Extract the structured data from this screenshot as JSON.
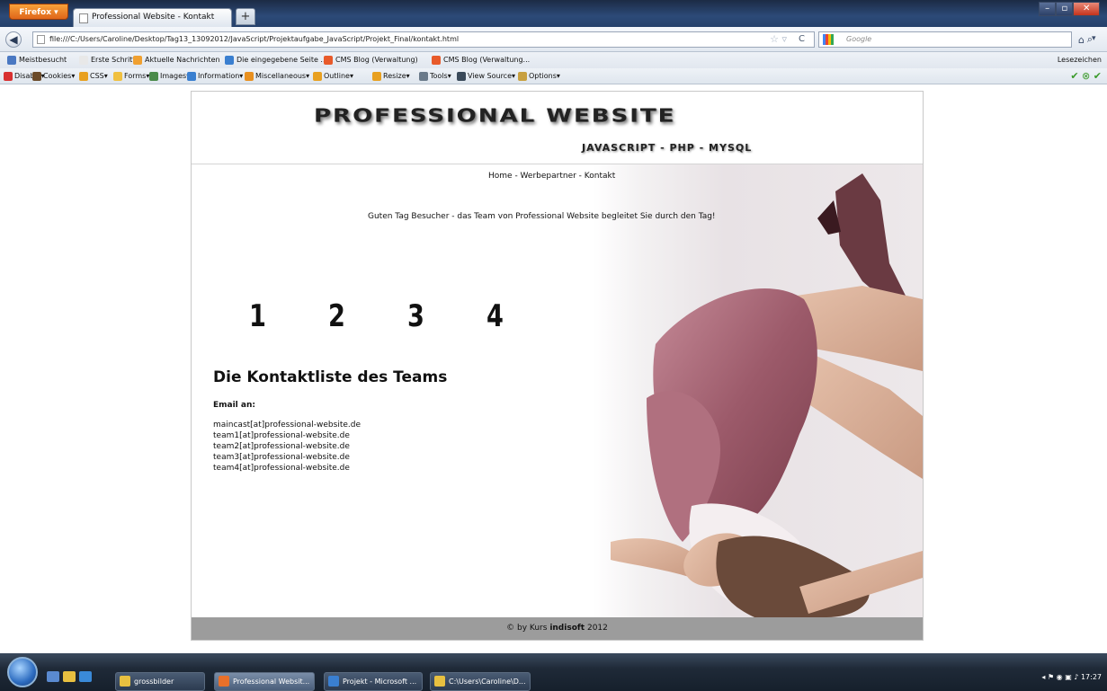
{
  "browser": {
    "menu_button": "Firefox ▾",
    "tab_title": "Professional Website - Kontakt",
    "new_tab": "+",
    "url": "file:///C:/Users/Caroline/Desktop/Tag13_13092012/JavaScript/Projektaufgabe_JavaScript/Projekt_Final/kontakt.html",
    "search_placeholder": "Google",
    "bookmarks": [
      {
        "label": "Meistbesucht",
        "color": "#4a78c2"
      },
      {
        "label": "Erste Schritte",
        "color": "#e8e8e8"
      },
      {
        "label": "Aktuelle Nachrichten",
        "color": "#f0a030"
      },
      {
        "label": "Die eingegebene Seite ...",
        "color": "#3a7fd0"
      },
      {
        "label": "CMS Blog (Verwaltung)",
        "color": "#e85a2a"
      },
      {
        "label": "CMS Blog (Verwaltung...",
        "color": "#e85a2a"
      }
    ],
    "bookmarks_right": "Lesezeichen",
    "devtools": [
      {
        "label": "Disable▾",
        "color": "#d83030"
      },
      {
        "label": "Cookies▾",
        "color": "#6a4a2a"
      },
      {
        "label": "CSS▾",
        "color": "#e8a020"
      },
      {
        "label": "Forms▾",
        "color": "#f0c040"
      },
      {
        "label": "Images▾",
        "color": "#4a8a4a"
      },
      {
        "label": "Information▾",
        "color": "#3a7fd0"
      },
      {
        "label": "Miscellaneous▾",
        "color": "#e89020"
      },
      {
        "label": "Outline▾",
        "color": "#e8a020"
      },
      {
        "label": "Resize▾",
        "color": "#e8a020"
      },
      {
        "label": "Tools▾",
        "color": "#6a7a8a"
      },
      {
        "label": "View Source▾",
        "color": "#3a4a5a"
      },
      {
        "label": "Options▾",
        "color": "#c8a040"
      }
    ],
    "status_icons": "✔ ⊗ ✔"
  },
  "site": {
    "logo": "PROFESSIONAL WEBSITE",
    "slogan": "JAVASCRIPT - PHP - MYSQL",
    "nav": "Home - Werbepartner - Kontakt",
    "greeting": "Guten Tag Besucher - das Team von Professional Website begleitet Sie durch den Tag!",
    "numbers": [
      "1",
      "2",
      "3",
      "4"
    ],
    "contact_title": "Die Kontaktliste des Teams",
    "email_label": "Email an:",
    "emails": [
      "maincast[at]professional-website.de",
      "team1[at]professional-website.de",
      "team2[at]professional-website.de",
      "team3[at]professional-website.de",
      "team4[at]professional-website.de"
    ],
    "footer_prefix": "© by Kurs",
    "footer_brand": "indisoft",
    "footer_year": "2012"
  },
  "taskbar": {
    "items": [
      {
        "label": "grossbilder",
        "color": "#e8c040"
      },
      {
        "label": "Professional Websit...",
        "color": "#e8702a"
      },
      {
        "label": "Projekt - Microsoft ...",
        "color": "#3a7fd0"
      },
      {
        "label": "C:\\Users\\Caroline\\D...",
        "color": "#e8c040"
      }
    ],
    "clock": "17:27"
  }
}
